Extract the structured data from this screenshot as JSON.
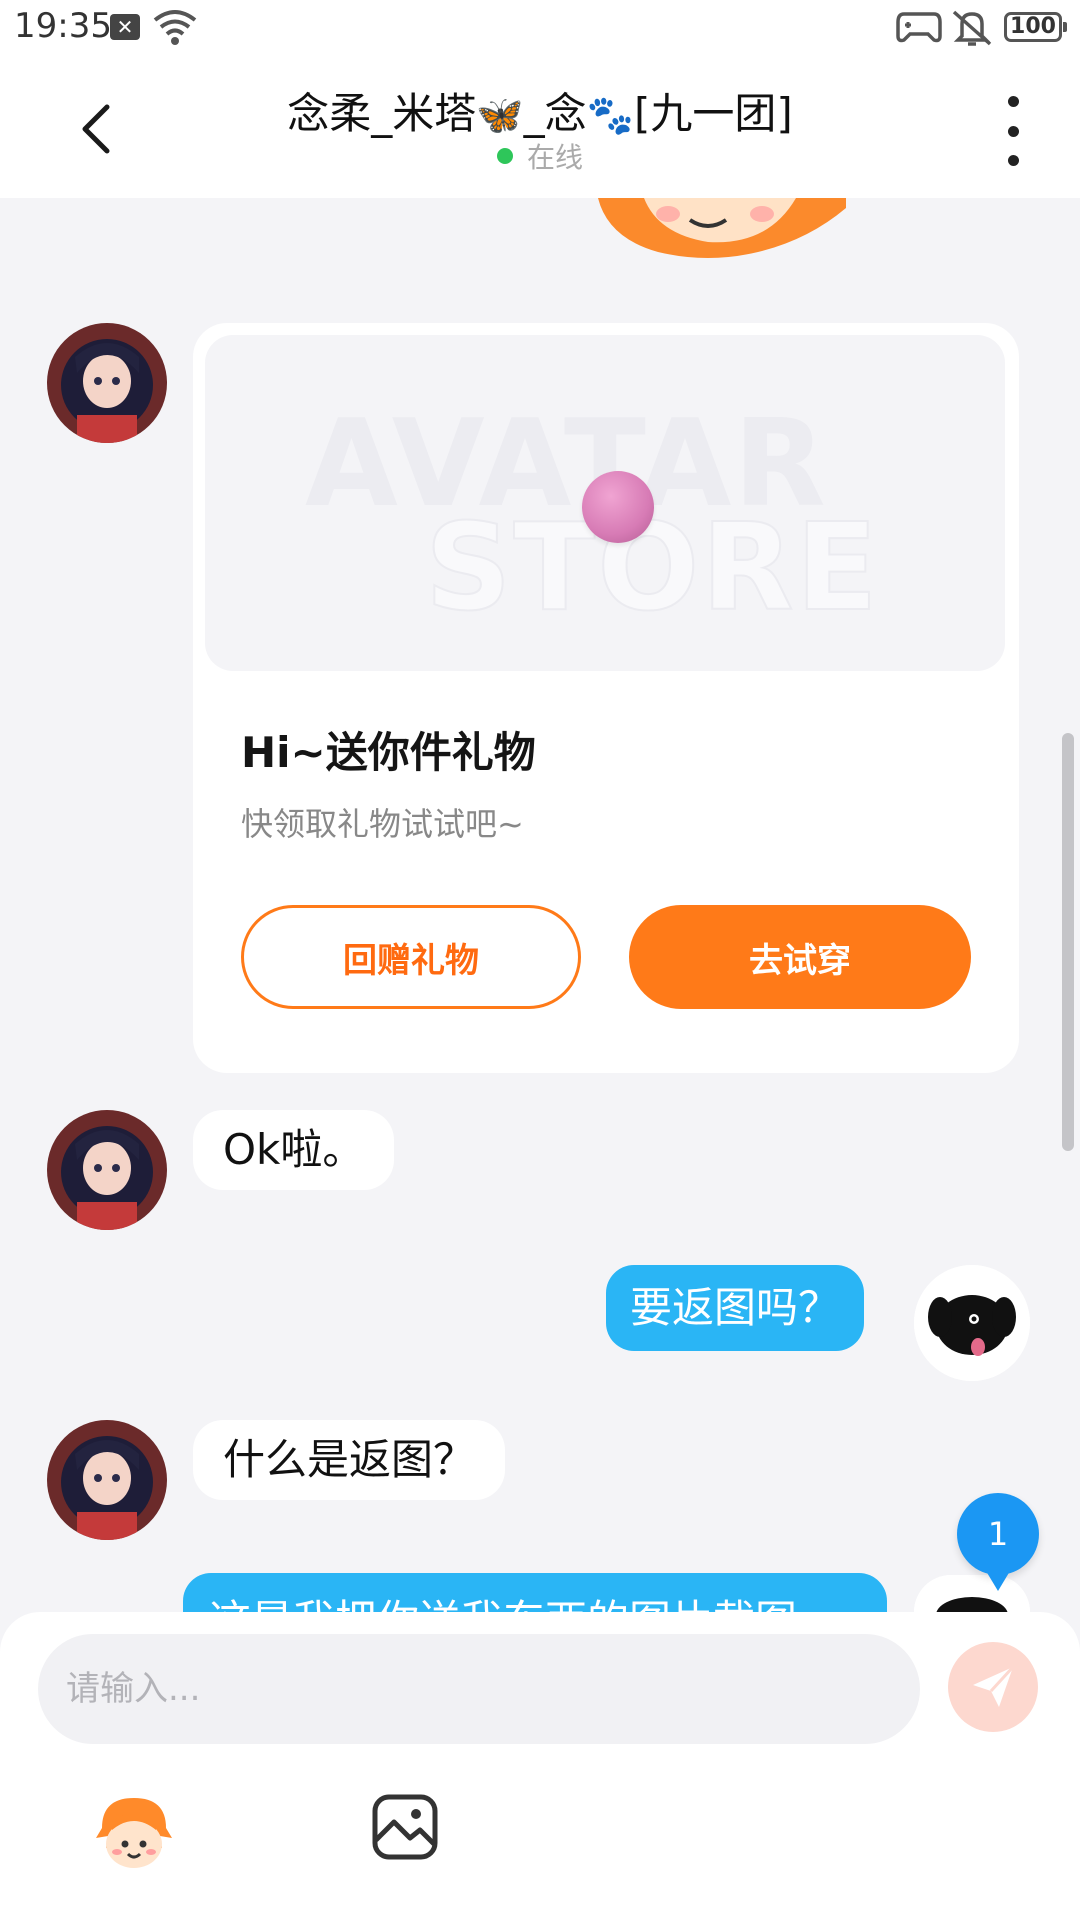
{
  "status_bar": {
    "time": "19:35",
    "battery": "100"
  },
  "header": {
    "title_part1": "念柔_米塔",
    "title_part2": "_念",
    "title_part3": "[九一团]",
    "emoji_1": "🦋",
    "emoji_2": "🐾",
    "status": "在线"
  },
  "gift_card": {
    "watermark_line1": "AVATAR",
    "watermark_line2": "STORE",
    "title": "Hi~送你件礼物",
    "subtitle": "快领取礼物试试吧~",
    "return_gift_label": "回赠礼物",
    "try_on_label": "去试穿"
  },
  "messages": [
    {
      "direction": "in",
      "text": "Ok啦。"
    },
    {
      "direction": "out",
      "text": "要返图吗？"
    },
    {
      "direction": "in",
      "text": "什么是返图？"
    },
    {
      "direction": "out",
      "text": "这是我把你送我东西的图片截图"
    }
  ],
  "unread_count": "1",
  "composer": {
    "placeholder": "请输入..."
  },
  "colors": {
    "accent_orange": "#ff7a18",
    "outgoing_bubble": "#2ab5f5",
    "badge_blue": "#1b97f3",
    "online_green": "#2ec65a"
  },
  "icons": [
    "x-notification-icon",
    "wifi-icon",
    "gamepad-icon",
    "bell-mute-icon",
    "battery-icon",
    "back-icon",
    "more-icon",
    "send-icon",
    "emoji-icon",
    "image-icon"
  ]
}
